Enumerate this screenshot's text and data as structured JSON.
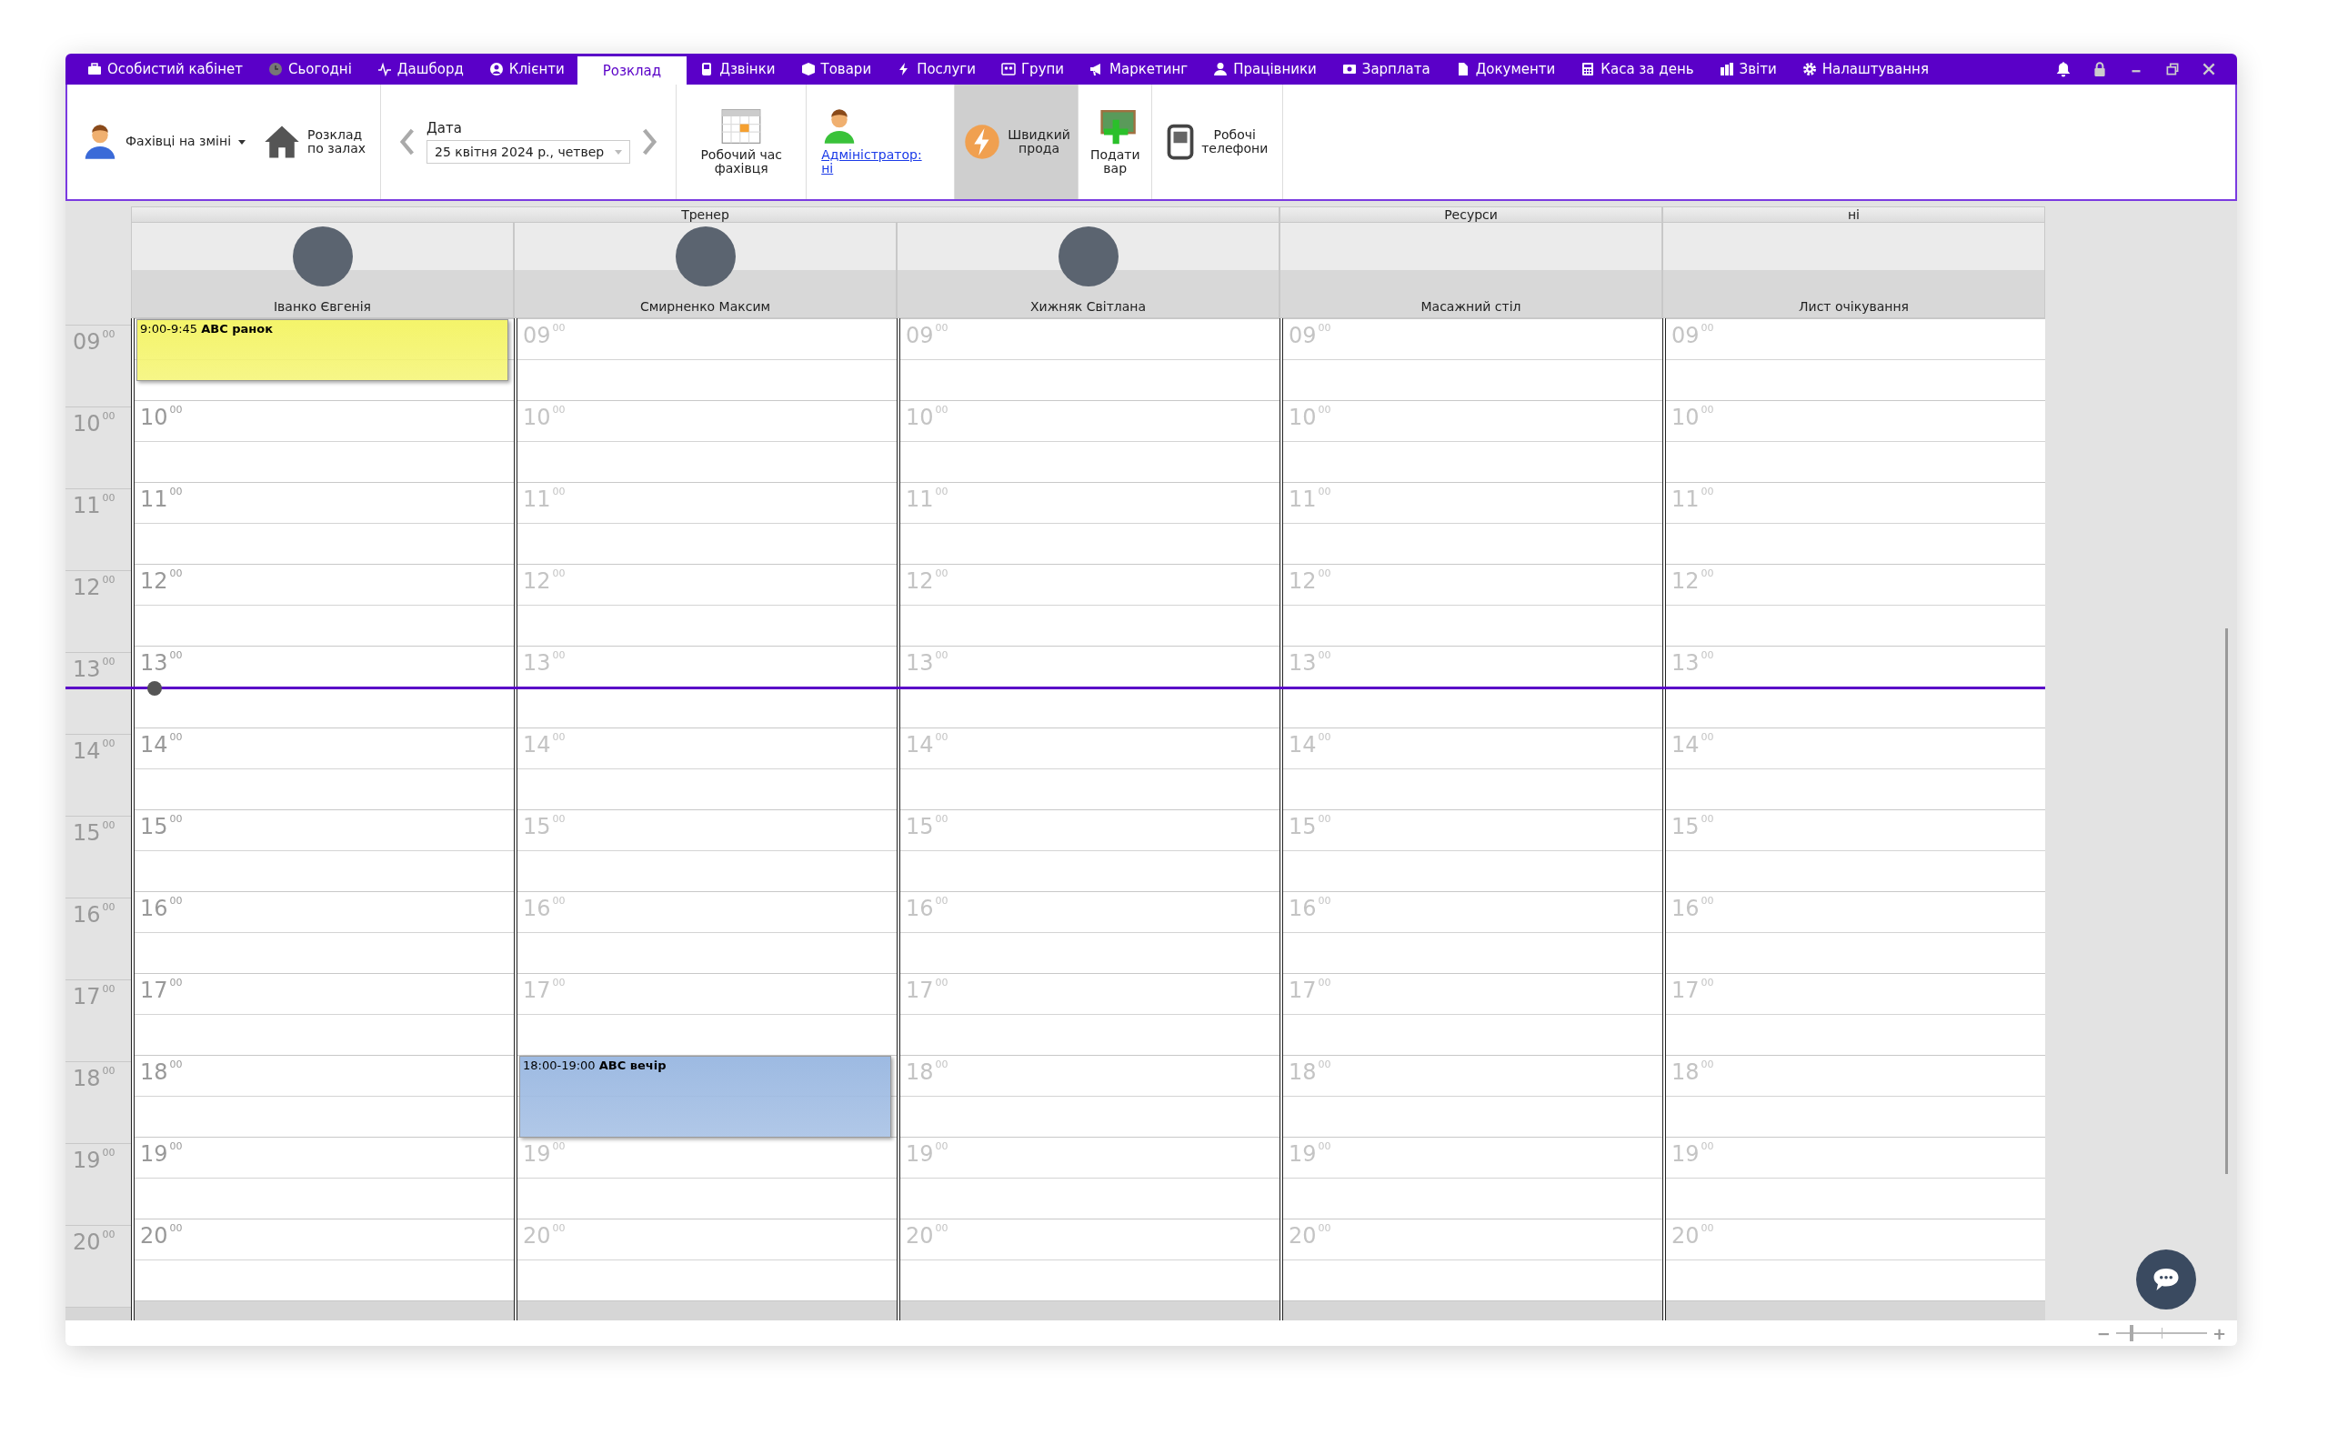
{
  "nav": {
    "tabs": [
      {
        "label": "Особистий кабінет",
        "selected": false
      },
      {
        "label": "Сьогодні",
        "selected": false
      },
      {
        "label": "Дашборд",
        "selected": false
      },
      {
        "label": "Клієнти",
        "selected": false
      },
      {
        "label": "Розклад",
        "selected": true
      },
      {
        "label": "Дзвінки",
        "selected": false
      },
      {
        "label": "Товари",
        "selected": false
      },
      {
        "label": "Послуги",
        "selected": false
      },
      {
        "label": "Групи",
        "selected": false
      },
      {
        "label": "Маркетинг",
        "selected": false
      },
      {
        "label": "Працівники",
        "selected": false
      },
      {
        "label": "Зарплата",
        "selected": false
      },
      {
        "label": "Документи",
        "selected": false
      },
      {
        "label": "Каса за день",
        "selected": false
      },
      {
        "label": "Звіти",
        "selected": false
      },
      {
        "label": "Налаштування",
        "selected": false
      }
    ]
  },
  "toolbar": {
    "staff_dropdown": {
      "label": "Фахівці на змінi"
    },
    "rooms_button": {
      "lines": [
        "Розклад",
        "по залах"
      ]
    },
    "date": {
      "label": "Дата",
      "value": "25 квітня 2024 р., четвер"
    },
    "work_time_button": {
      "lines": [
        "Робочий час",
        "фахівця"
      ]
    },
    "admin_link": {
      "lines": [
        "Адміністратор:",
        "ні"
      ]
    },
    "quick_sale_button": {
      "lines": [
        "Швидкий",
        "прода"
      ],
      "selected": true
    },
    "add_product_button": {
      "lines": [
        "Подати",
        "вар"
      ],
      "selected": false
    },
    "phones_button": {
      "lines": [
        "Робочі",
        "телефони"
      ],
      "selected": false
    }
  },
  "time_column": {
    "hours": [
      {
        "h": "09",
        "m": "00",
        "now": false
      },
      {
        "h": "10",
        "m": "00",
        "now": false
      },
      {
        "h": "11",
        "m": "00",
        "now": false
      },
      {
        "h": "12",
        "m": "00",
        "now": false
      },
      {
        "h": "13",
        "m": "00",
        "now": true
      },
      {
        "h": "14",
        "m": "00",
        "now": false
      },
      {
        "h": "15",
        "m": "00",
        "now": false
      },
      {
        "h": "16",
        "m": "00",
        "now": false
      },
      {
        "h": "17",
        "m": "00",
        "now": false
      },
      {
        "h": "18",
        "m": "00",
        "now": false
      },
      {
        "h": "19",
        "m": "00",
        "now": false
      },
      {
        "h": "20",
        "m": "00",
        "now": false
      }
    ]
  },
  "groups": [
    {
      "title": "Тренер",
      "columns": [
        {
          "name": "Іванко Євгенія",
          "kind": "person",
          "active": true,
          "hours": [
            {
              "event": {
                "text": "9:00-9:45 **ABC ранок**",
                "color": "#f4f46a"
              }
            },
            {
              "h": "10",
              "m": "00"
            },
            {
              "h": "11",
              "m": "00"
            },
            {
              "h": "12",
              "m": "00"
            },
            {
              "h": "13",
              "m": "00"
            },
            {
              "h": "14",
              "m": "00"
            },
            {
              "h": "15",
              "m": "00"
            },
            {
              "h": "16",
              "m": "00"
            },
            {
              "h": "17",
              "m": "00"
            },
            {
              "h": "18",
              "m": "00"
            },
            {
              "h": "19",
              "m": "00"
            },
            {
              "h": "20",
              "m": "00"
            }
          ]
        },
        {
          "name": "Смирненко Максим",
          "kind": "person",
          "active": false,
          "hours": [
            {
              "h": "09",
              "m": "00"
            },
            {
              "h": "10",
              "m": "00"
            },
            {
              "h": "11",
              "m": "00"
            },
            {
              "h": "12",
              "m": "00"
            },
            {
              "h": "13",
              "m": "00"
            },
            {
              "h": "14",
              "m": "00"
            },
            {
              "h": "15",
              "m": "00"
            },
            {
              "h": "16",
              "m": "00"
            },
            {
              "h": "17",
              "m": "00"
            },
            {
              "event": {
                "text": "18:00-19:00 **ABC вечір**",
                "color": "#9dbae2"
              }
            },
            {
              "h": "19",
              "m": "00"
            },
            {
              "h": "20",
              "m": "00"
            }
          ]
        },
        {
          "name": "Хижняк Світлана",
          "kind": "person",
          "active": false,
          "hours": [
            {
              "h": "09",
              "m": "00"
            },
            {
              "h": "10",
              "m": "00"
            },
            {
              "h": "11",
              "m": "00"
            },
            {
              "h": "12",
              "m": "00"
            },
            {
              "h": "13",
              "m": "00"
            },
            {
              "h": "14",
              "m": "00"
            },
            {
              "h": "15",
              "m": "00"
            },
            {
              "h": "16",
              "m": "00"
            },
            {
              "h": "17",
              "m": "00"
            },
            {
              "h": "18",
              "m": "00"
            },
            {
              "h": "19",
              "m": "00"
            },
            {
              "h": "20",
              "m": "00"
            }
          ]
        }
      ]
    },
    {
      "title": "Ресурси",
      "columns": [
        {
          "name": "Масажний стіл",
          "kind": "resource",
          "active": false,
          "hours": [
            {
              "h": "09",
              "m": "00"
            },
            {
              "h": "10",
              "m": "00"
            },
            {
              "h": "11",
              "m": "00"
            },
            {
              "h": "12",
              "m": "00"
            },
            {
              "h": "13",
              "m": "00"
            },
            {
              "h": "14",
              "m": "00"
            },
            {
              "h": "15",
              "m": "00"
            },
            {
              "h": "16",
              "m": "00"
            },
            {
              "h": "17",
              "m": "00"
            },
            {
              "h": "18",
              "m": "00"
            },
            {
              "h": "19",
              "m": "00"
            },
            {
              "h": "20",
              "m": "00"
            }
          ]
        }
      ]
    },
    {
      "title": "ні",
      "columns": [
        {
          "name": "Лист очікування",
          "kind": "resource",
          "active": false,
          "hours": [
            {
              "h": "09",
              "m": "00"
            },
            {
              "h": "10",
              "m": "00"
            },
            {
              "h": "11",
              "m": "00"
            },
            {
              "h": "12",
              "m": "00"
            },
            {
              "h": "13",
              "m": "00"
            },
            {
              "h": "14",
              "m": "00"
            },
            {
              "h": "15",
              "m": "00"
            },
            {
              "h": "16",
              "m": "00"
            },
            {
              "h": "17",
              "m": "00"
            },
            {
              "h": "18",
              "m": "00"
            },
            {
              "h": "19",
              "m": "00"
            },
            {
              "h": "20",
              "m": "00"
            }
          ]
        }
      ]
    }
  ],
  "zoom": {
    "minus": "−",
    "plus": "+",
    "level": 0.15
  }
}
